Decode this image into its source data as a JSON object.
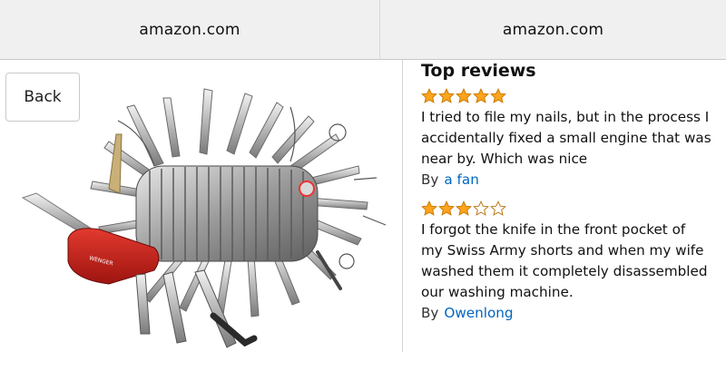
{
  "browser": {
    "left_url": "amazon.com",
    "right_url": "amazon.com"
  },
  "nav": {
    "back_label": "Back"
  },
  "reviews_section": {
    "title": "Top reviews",
    "star_color": "#ffa41c",
    "link_color": "#0066c0",
    "reviews": [
      {
        "rating": 5,
        "max_rating": 5,
        "text_lines": [
          "I tried to file my nails, but in the process I",
          "accidentally fixed a small engine that was",
          "near by. Which was nice"
        ],
        "by_label": "By",
        "author": "a fan"
      },
      {
        "rating": 3,
        "max_rating": 5,
        "text_lines": [
          "I forgot the knife in the front pocket of",
          "my Swiss Army shorts and when my wife",
          "washed them it completely disassembled",
          "our washing machine."
        ],
        "by_label": "By",
        "author": "Owenlong"
      }
    ]
  },
  "product": {
    "icon": "swiss-army-knife-image",
    "brand_mark": "WENGER"
  }
}
